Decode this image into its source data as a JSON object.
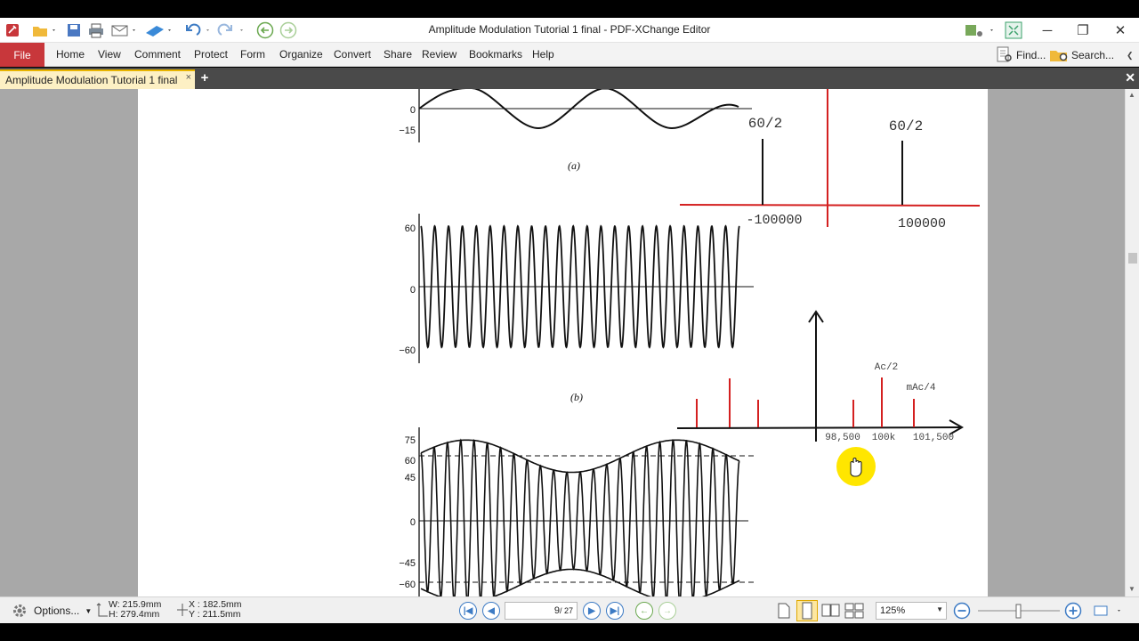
{
  "window": {
    "title": "Amplitude  Modulation Tutorial 1 final - PDF-XChange Editor"
  },
  "menu": {
    "file": "File",
    "items": [
      "Home",
      "View",
      "Comment",
      "Protect",
      "Form",
      "Organize",
      "Convert",
      "Share",
      "Review",
      "Bookmarks",
      "Help"
    ],
    "find": "Find...",
    "search": "Search..."
  },
  "tabs": {
    "active": "Amplitude  Modulation Tutorial 1 final",
    "close_glyph": "×",
    "add_glyph": "+"
  },
  "document": {
    "fig_a": {
      "caption": "(a)",
      "ticks": [
        "0",
        "−15"
      ]
    },
    "fig_b": {
      "caption": "(b)",
      "ticks": [
        "60",
        "0",
        "−60"
      ]
    },
    "fig_c": {
      "ticks": [
        "75",
        "60",
        "45",
        "0",
        "−45",
        "−60"
      ]
    },
    "spectrum1": {
      "left_label": "60/2",
      "right_label": "60/2",
      "left_freq": "-100000",
      "right_freq": "100000",
      "axis_color": "#d42020"
    },
    "spectrum2": {
      "carrier_label": "Ac/2",
      "sideband_label": "mAc/4",
      "ticks": [
        "98,500",
        "100k",
        "101,500"
      ],
      "line_color": "#d42020"
    },
    "cursor": {
      "icon": "hand-cursor-icon",
      "highlight_color": "#ffe600"
    }
  },
  "status": {
    "options": "Options...",
    "width": "W: 215.9mm",
    "height": "H: 279.4mm",
    "x": "X : 182.5mm",
    "y": "Y : 211.5mm",
    "page_current": "9",
    "page_total": "/ 27",
    "zoom": "125%"
  }
}
